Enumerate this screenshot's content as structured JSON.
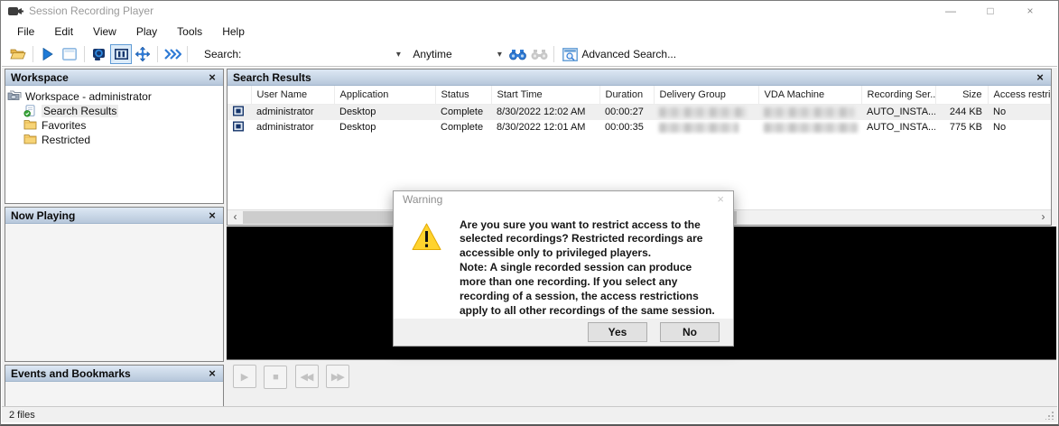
{
  "window": {
    "title": "Session Recording Player",
    "controls": {
      "minimize": "—",
      "maximize": "□",
      "close": "×"
    }
  },
  "menu": {
    "items": [
      "File",
      "Edit",
      "View",
      "Play",
      "Tools",
      "Help"
    ]
  },
  "toolbar": {
    "search_label": "Search:",
    "search_placeholder": "",
    "time_filter": "Anytime",
    "advanced_search_label": "Advanced Search...",
    "icons": [
      "open-folder",
      "play",
      "snapshot",
      "screen-cast",
      "frame",
      "pan-move",
      "fast-chevrons",
      "find-binoculars",
      "find-binoculars-disabled",
      "advanced-search-window"
    ]
  },
  "icons": {
    "panel_close": "×",
    "dialog_close": "×",
    "dropdown": "▾",
    "scroll_left": "‹",
    "scroll_right": "›",
    "play": "▶",
    "stop": "■",
    "rewind": "◀◀",
    "forward": "▶▶"
  },
  "panels": {
    "workspace": {
      "title": "Workspace",
      "tree": [
        {
          "label": "Workspace - administrator",
          "icon": "workspace-folders",
          "selected": false
        },
        {
          "label": "Search Results",
          "icon": "search-results-doc-check",
          "selected": true
        },
        {
          "label": "Favorites",
          "icon": "folder",
          "selected": false
        },
        {
          "label": "Restricted",
          "icon": "folder",
          "selected": false
        }
      ]
    },
    "now_playing": {
      "title": "Now Playing"
    },
    "events": {
      "title": "Events and Bookmarks"
    }
  },
  "results": {
    "title": "Search Results",
    "columns": [
      "User Name",
      "Application",
      "Status",
      "Start Time",
      "Duration",
      "Delivery Group",
      "VDA Machine",
      "Recording Ser...",
      "Size",
      "Access restrict..."
    ],
    "rows": [
      {
        "user": "administrator",
        "app": "Desktop",
        "status": "Complete",
        "start": "8/30/2022 12:02 AM",
        "duration": "00:00:27",
        "delivery_blurred": true,
        "vda_blurred": true,
        "server": "AUTO_INSTA...",
        "size": "244 KB",
        "access": "No"
      },
      {
        "user": "administrator",
        "app": "Desktop",
        "status": "Complete",
        "start": "8/30/2022 12:01 AM",
        "duration": "00:00:35",
        "delivery_blurred": true,
        "vda_blurred": true,
        "server": "AUTO_INSTA...",
        "size": "775 KB",
        "access": "No"
      }
    ]
  },
  "dialog": {
    "title": "Warning",
    "message": "Are you sure you want to restrict access to the selected recordings? Restricted recordings are accessible only to privileged players.\nNote: A single recorded session can produce more than one recording. If you select any recording of a session, the access restrictions apply to all other recordings of the same session.",
    "yes_label": "Yes",
    "no_label": "No"
  },
  "status_bar": {
    "text": "2 files"
  },
  "colors": {
    "panel_header_top": "#dde8f4",
    "panel_header_bottom": "#b7c7db",
    "accent_blue": "#2f7bd6",
    "warning_yellow": "#ffd32e",
    "video_bg": "#000000",
    "chrome_bg": "#f0f0f0"
  }
}
